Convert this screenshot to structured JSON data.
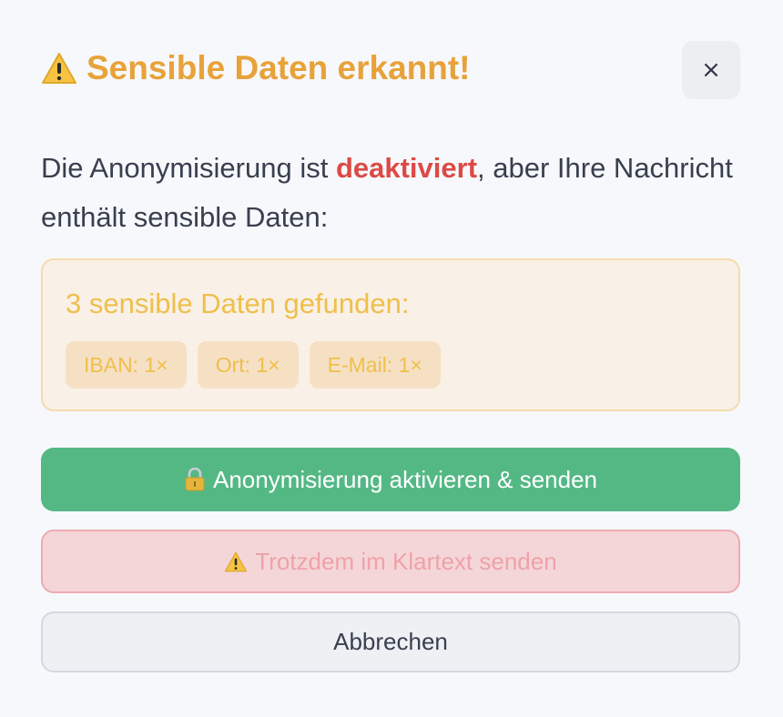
{
  "dialog": {
    "title": "Sensible Daten erkannt!",
    "title_icon": "warning-icon",
    "close_label": "×",
    "close_icon": "close-icon"
  },
  "message": {
    "part1": "Die Anonymisierung ist ",
    "highlight": "deaktiviert",
    "part2": ", aber Ihre Nachricht enthält sensible Daten:"
  },
  "detection": {
    "summary": "3 sensible Daten gefunden:",
    "items": [
      {
        "label": "IBAN: 1×"
      },
      {
        "label": "Ort: 1×"
      },
      {
        "label": "E-Mail: 1×"
      }
    ]
  },
  "actions": {
    "anonymize_label": "Anonymisierung aktivieren & senden",
    "anonymize_icon": "lock-icon",
    "plaintext_label": "Trotzdem im Klartext senden",
    "plaintext_icon": "warning-icon",
    "cancel_label": "Abbrechen"
  },
  "colors": {
    "title": "#e8a23a",
    "highlight_red": "#dc4a46",
    "primary_green": "#54b885",
    "danger_bg": "#f4d6d9",
    "info_bg": "#f9f0e7",
    "info_text": "#efbf4a"
  }
}
